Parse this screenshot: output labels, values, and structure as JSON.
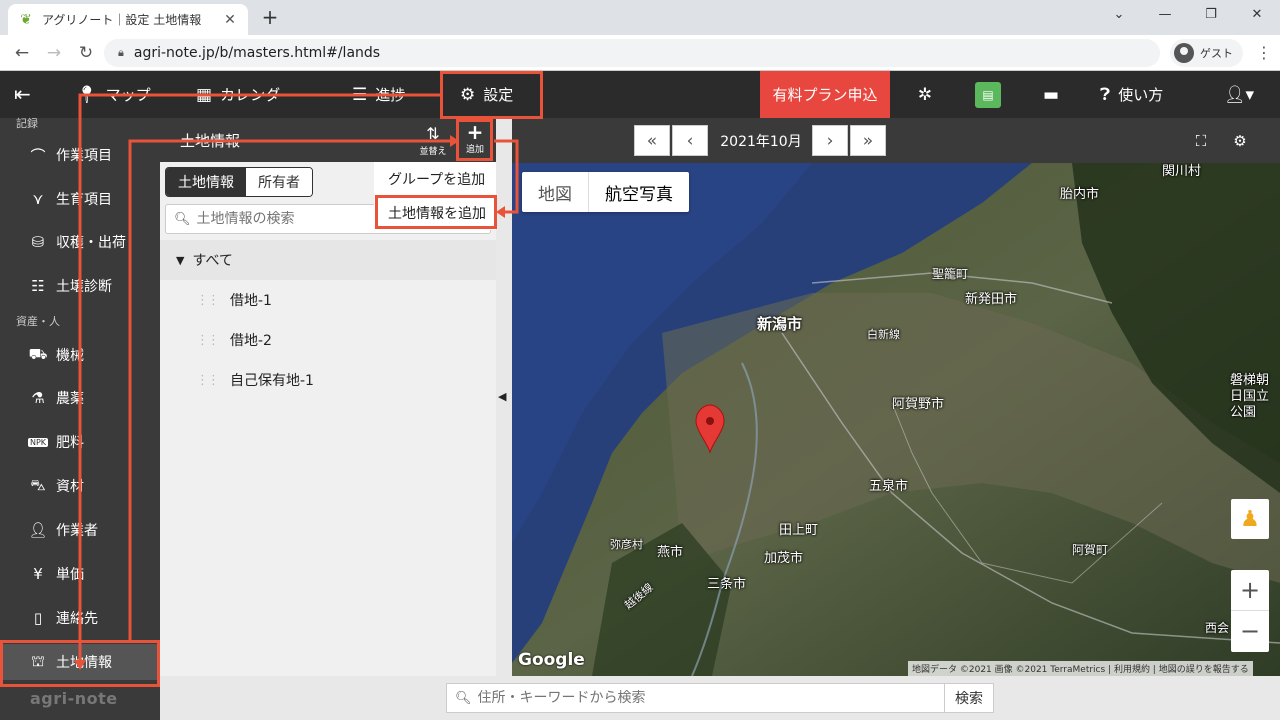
{
  "browser": {
    "tab_title": "アグリノート｜設定 土地情報",
    "new_tab": "+",
    "url": "agri-note.jp/b/masters.html#/lands",
    "profile_label": "ゲスト"
  },
  "topnav": {
    "items": [
      {
        "label": "マップ",
        "icon": "map-pin-icon"
      },
      {
        "label": "カレンダー",
        "icon": "calendar-icon"
      },
      {
        "label": "進捗",
        "icon": "progress-list-icon"
      },
      {
        "label": "設定",
        "icon": "gear-icon"
      }
    ],
    "plan_button": "有料プラン申込",
    "help_label": "使い方"
  },
  "sidebar": {
    "section_record": "記録",
    "section_assets": "資産・人",
    "items": [
      {
        "label": "作業項目",
        "icon": "work-icon"
      },
      {
        "label": "生育項目",
        "icon": "growth-icon"
      },
      {
        "label": "収穫・出荷",
        "icon": "basket-icon"
      },
      {
        "label": "土壌診断",
        "icon": "soil-sliders-icon"
      },
      {
        "label": "機械",
        "icon": "tractor-icon"
      },
      {
        "label": "農薬",
        "icon": "flask-icon"
      },
      {
        "label": "肥料",
        "icon": "npk-icon"
      },
      {
        "label": "資材",
        "icon": "wheelbarrow-icon"
      },
      {
        "label": "作業者",
        "icon": "person-icon"
      },
      {
        "label": "単価",
        "icon": "money-bag-icon"
      },
      {
        "label": "連絡先",
        "icon": "phone-icon"
      },
      {
        "label": "土地情報",
        "icon": "land-icon"
      }
    ],
    "brand": "agri-note"
  },
  "panel": {
    "title": "土地情報",
    "sort_label": "並替え",
    "add_label": "追加",
    "seg_active": "土地情報",
    "seg_inactive": "所有者",
    "search_placeholder": "土地情報の検索",
    "tree_root": "すべて",
    "tree_items": [
      "借地-1",
      "借地-2",
      "自己保有地-1"
    ],
    "dropdown": [
      "グループを追加",
      "土地情報を追加"
    ]
  },
  "map_toolbar": {
    "month": "2021年10月"
  },
  "map": {
    "type_options": [
      "地図",
      "航空写真"
    ],
    "selected_type": "航空写真",
    "cities": [
      {
        "name": "新潟市",
        "big": true
      },
      {
        "name": "新発田市"
      },
      {
        "name": "阿賀野市"
      },
      {
        "name": "五泉市"
      },
      {
        "name": "田上町"
      },
      {
        "name": "加茂市"
      },
      {
        "name": "燕市"
      },
      {
        "name": "弥彦村"
      },
      {
        "name": "三条市"
      },
      {
        "name": "聖籠町"
      },
      {
        "name": "胎内市"
      },
      {
        "name": "関川村"
      },
      {
        "name": "白新線"
      },
      {
        "name": "磐梯朝日国立公園"
      },
      {
        "name": "阿賀町"
      },
      {
        "name": "越後線"
      },
      {
        "name": "西会"
      }
    ],
    "google": "Google",
    "attribution": "地図データ ©2021 画像 ©2021 TerraMetrics | 利用規約 | 地図の誤りを報告する",
    "zoom_in": "+",
    "zoom_out": "−"
  },
  "bottom": {
    "search_placeholder": "住所・キーワードから検索",
    "search_button": "検索"
  },
  "colors": {
    "highlight": "#e8533a",
    "plan": "#e8473f",
    "nav_bg": "#2b2b2b",
    "sidebar_bg": "#3a3a3a"
  }
}
